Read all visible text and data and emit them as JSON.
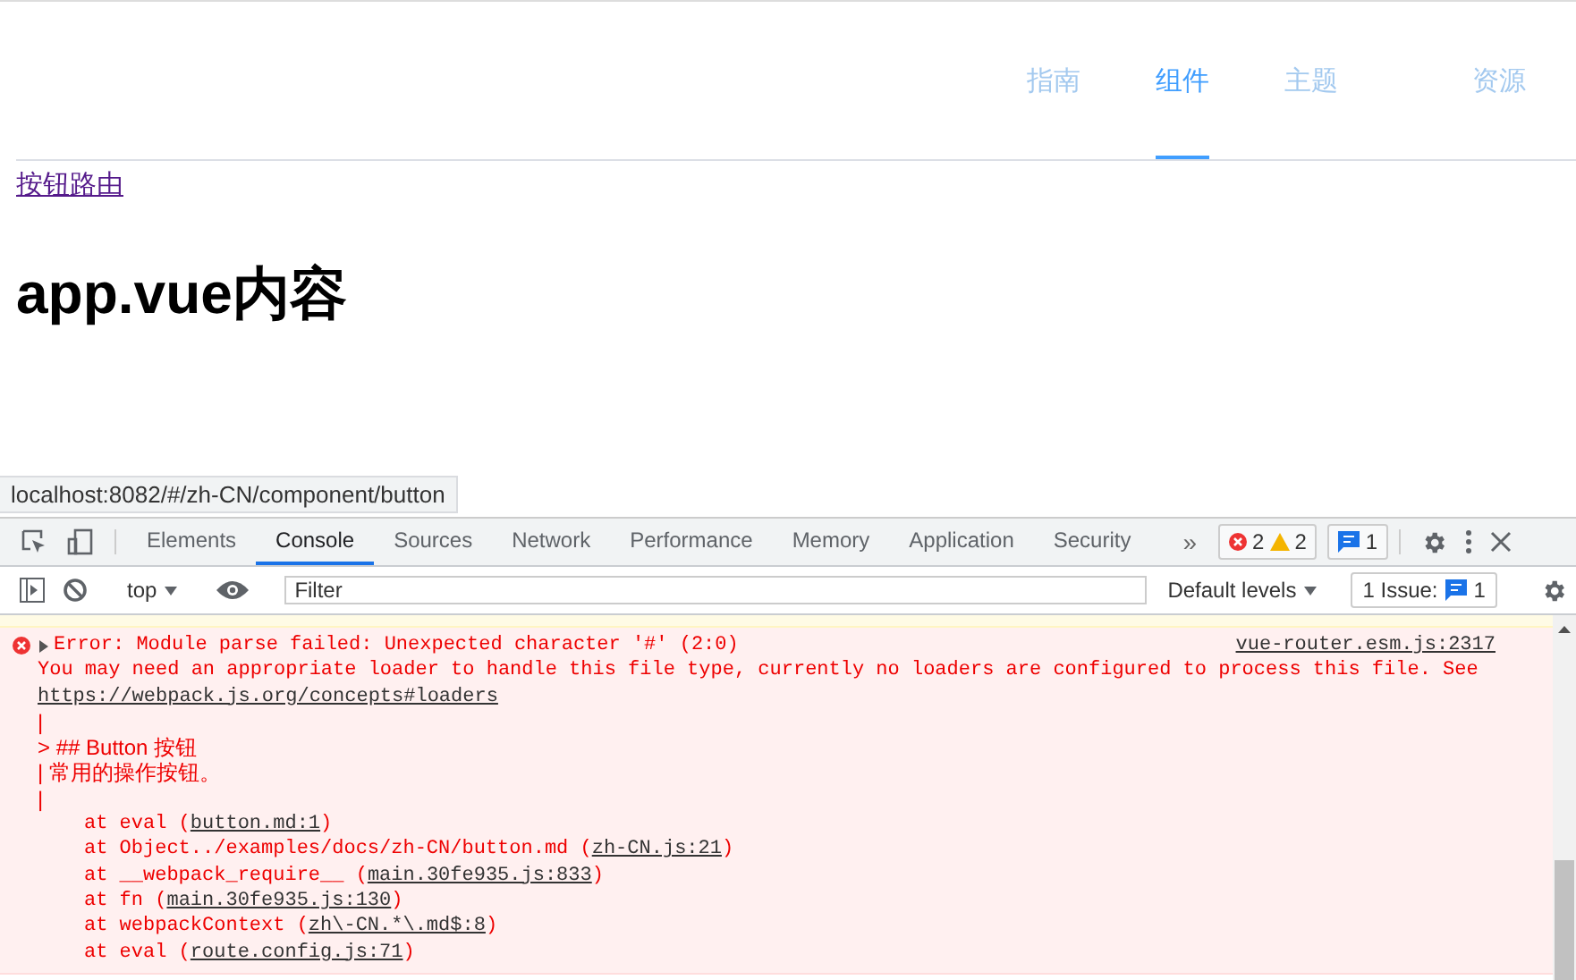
{
  "site_nav": {
    "items": [
      {
        "label": "指南",
        "selected": false
      },
      {
        "label": "组件",
        "selected": true
      },
      {
        "label": "主题",
        "selected": false
      },
      {
        "label": "资源",
        "selected": false
      }
    ]
  },
  "page": {
    "link": "按钮路由",
    "heading": "app.vue内容"
  },
  "status_url": "localhost:8082/#/zh-CN/component/button",
  "devtools": {
    "tabs": [
      {
        "label": "Elements",
        "selected": false
      },
      {
        "label": "Console",
        "selected": true
      },
      {
        "label": "Sources",
        "selected": false
      },
      {
        "label": "Network",
        "selected": false
      },
      {
        "label": "Performance",
        "selected": false
      },
      {
        "label": "Memory",
        "selected": false
      },
      {
        "label": "Application",
        "selected": false
      },
      {
        "label": "Security",
        "selected": false
      }
    ],
    "more": "»",
    "errors": "2",
    "warnings": "2",
    "messages": "1"
  },
  "console_toolbar": {
    "context": "top",
    "filter_placeholder": "Filter",
    "levels": "Default levels",
    "issues_label": "1 Issue:",
    "issues_count": "1"
  },
  "error": {
    "expanded": false,
    "title": "Error: Module parse failed: Unexpected character '#' (2:0)",
    "source": "vue-router.esm.js:2317",
    "detail": "You may need an appropriate loader to handle this file type, currently no loaders are configured to process this file. See",
    "detail_link": "https://webpack.js.org/concepts#loaders",
    "code": [
      "|",
      "> ## Button 按钮",
      "| 常用的操作按钮。",
      "|"
    ],
    "stack": [
      {
        "text": "at eval (",
        "link": "button.md:1",
        "end": ")"
      },
      {
        "text": "at Object../examples/docs/zh-CN/button.md (",
        "link": "zh-CN.js:21",
        "end": ")"
      },
      {
        "text": "at __webpack_require__ (",
        "link": "main.30fe935.js:833",
        "end": ")"
      },
      {
        "text": "at fn (",
        "link": "main.30fe935.js:130",
        "end": ")"
      },
      {
        "text": "at webpackContext (",
        "link": "zh\\-CN.*\\.md$:8",
        "end": ")"
      },
      {
        "text": "at eval (",
        "link": "route.config.js:71",
        "end": ")"
      }
    ]
  }
}
